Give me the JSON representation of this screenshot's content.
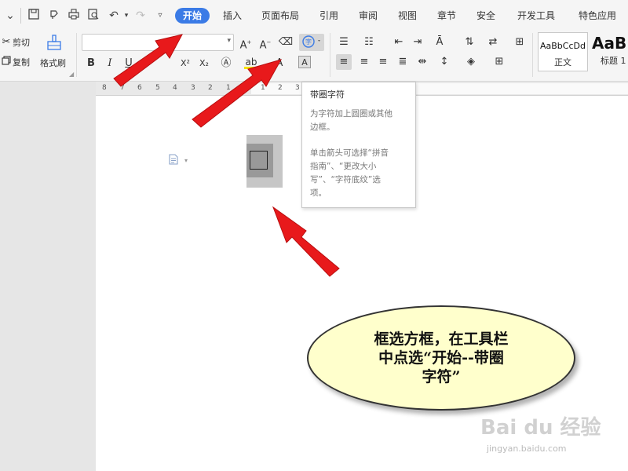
{
  "menu": {
    "tabs": [
      "开始",
      "插入",
      "页面布局",
      "引用",
      "审阅",
      "视图",
      "章节",
      "安全",
      "开发工具",
      "特色应用"
    ],
    "active_tab": "开始"
  },
  "ribbon": {
    "cut_label": "剪切",
    "copy_label": "复制",
    "format_painter_label": "格式刷",
    "bold": "B",
    "italic": "I",
    "underline": "U",
    "superscript": "X²",
    "subscript": "X₂",
    "font_color_letter": "A",
    "highlight_letter": "ab",
    "styles": [
      {
        "preview": "AaBbCcDd",
        "name": "正文"
      },
      {
        "preview": "AaB",
        "name": "标题 1"
      }
    ]
  },
  "ruler": {
    "numbers": [
      "8",
      "7",
      "6",
      "5",
      "4",
      "3",
      "2",
      "1",
      "1",
      "2",
      "3"
    ]
  },
  "tooltip": {
    "title": "带圈字符",
    "line1": "为字符加上圆圈或其他",
    "line2": "边框。",
    "line3": "单击箭头可选择“拼音",
    "line4": "指南”、“更改大小",
    "line5": "写”、“字符底纹”选",
    "line6": "项。"
  },
  "annotation": {
    "line1": "框选方框，在工具栏",
    "line2": "中点选“开始--带圈",
    "line3": "字符”"
  },
  "watermark": {
    "logo": "Bai du 经验",
    "url": "jingyan.baidu.com"
  },
  "colors": {
    "accent": "#3b7be6",
    "arrow": "#e8191b",
    "bubble_fill": "#ffffcc",
    "highlight": "#f5e400"
  }
}
